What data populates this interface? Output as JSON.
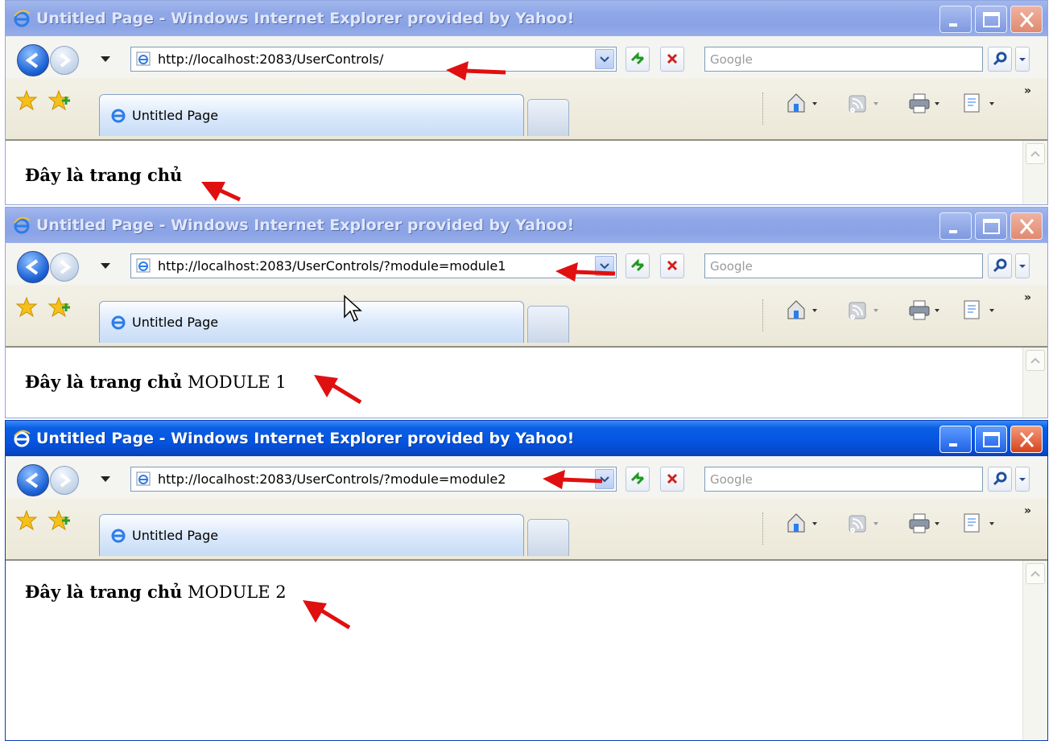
{
  "windows": [
    {
      "state": "inactive",
      "title": "Untitled Page - Windows Internet Explorer provided by Yahoo!",
      "address": "http://localhost:2083/UserControls/",
      "search_placeholder": "Google",
      "tab_label": "Untitled Page",
      "page_bold": "Đây là trang chủ",
      "page_module": ""
    },
    {
      "state": "inactive",
      "title": "Untitled Page - Windows Internet Explorer provided by Yahoo!",
      "address": "http://localhost:2083/UserControls/?module=module1",
      "search_placeholder": "Google",
      "tab_label": "Untitled Page",
      "page_bold": "Đây là trang chủ",
      "page_module": "MODULE 1"
    },
    {
      "state": "active",
      "title": "Untitled Page - Windows Internet Explorer provided by Yahoo!",
      "address": "http://localhost:2083/UserControls/?module=module2",
      "search_placeholder": "Google",
      "tab_label": "Untitled Page",
      "page_bold": "Đây là trang chủ",
      "page_module": "MODULE 2"
    }
  ],
  "toolbar_overflow": "»",
  "colors": {
    "annotation_arrow": "#e01010",
    "active_title": "#0554e0",
    "inactive_title": "#8fa7e7"
  },
  "icons": [
    "ie-logo-icon",
    "back-icon",
    "forward-icon",
    "page-icon",
    "refresh-icon",
    "stop-icon",
    "search-icon",
    "favorites-star-icon",
    "add-favorites-icon",
    "home-icon",
    "feeds-icon",
    "print-icon",
    "page-menu-icon"
  ]
}
